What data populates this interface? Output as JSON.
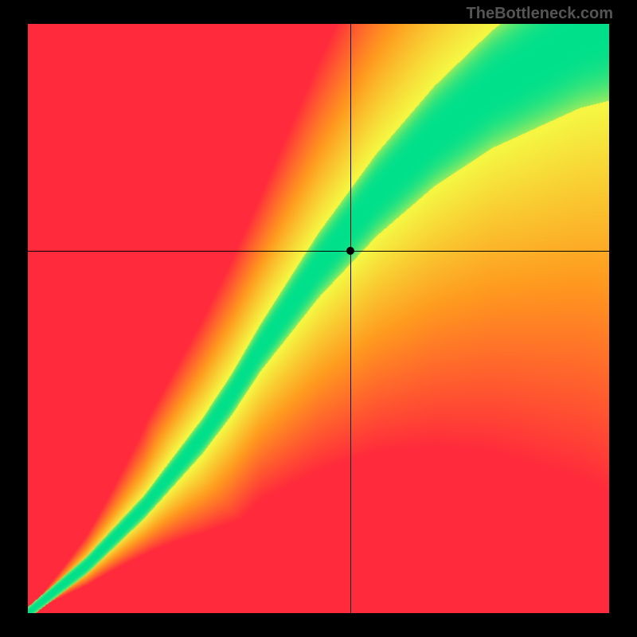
{
  "watermark": "TheBottleneck.com",
  "chart_data": {
    "type": "heatmap",
    "title": "",
    "xlabel": "",
    "ylabel": "",
    "xlim": [
      0,
      1
    ],
    "ylim": [
      0,
      1
    ],
    "crosshair": {
      "x": 0.555,
      "y": 0.615
    },
    "ridge": [
      {
        "x": 0.0,
        "y": 0.0
      },
      {
        "x": 0.05,
        "y": 0.04
      },
      {
        "x": 0.1,
        "y": 0.08
      },
      {
        "x": 0.15,
        "y": 0.13
      },
      {
        "x": 0.2,
        "y": 0.18
      },
      {
        "x": 0.25,
        "y": 0.24
      },
      {
        "x": 0.3,
        "y": 0.3
      },
      {
        "x": 0.35,
        "y": 0.37
      },
      {
        "x": 0.4,
        "y": 0.45
      },
      {
        "x": 0.45,
        "y": 0.52
      },
      {
        "x": 0.5,
        "y": 0.59
      },
      {
        "x": 0.55,
        "y": 0.65
      },
      {
        "x": 0.6,
        "y": 0.71
      },
      {
        "x": 0.65,
        "y": 0.76
      },
      {
        "x": 0.7,
        "y": 0.81
      },
      {
        "x": 0.75,
        "y": 0.85
      },
      {
        "x": 0.8,
        "y": 0.89
      },
      {
        "x": 0.85,
        "y": 0.92
      },
      {
        "x": 0.9,
        "y": 0.95
      },
      {
        "x": 0.95,
        "y": 0.98
      },
      {
        "x": 1.0,
        "y": 1.0
      }
    ],
    "ridge_width": [
      {
        "x": 0.0,
        "w": 0.01
      },
      {
        "x": 0.1,
        "w": 0.015
      },
      {
        "x": 0.2,
        "w": 0.02
      },
      {
        "x": 0.3,
        "w": 0.03
      },
      {
        "x": 0.4,
        "w": 0.04
      },
      {
        "x": 0.5,
        "w": 0.055
      },
      {
        "x": 0.6,
        "w": 0.07
      },
      {
        "x": 0.7,
        "w": 0.085
      },
      {
        "x": 0.8,
        "w": 0.1
      },
      {
        "x": 0.9,
        "w": 0.115
      },
      {
        "x": 1.0,
        "w": 0.13
      }
    ],
    "colors": {
      "ridge": "#00e08c",
      "near": "#f5f542",
      "mid": "#ff9a1f",
      "far": "#ff2a3c"
    }
  }
}
